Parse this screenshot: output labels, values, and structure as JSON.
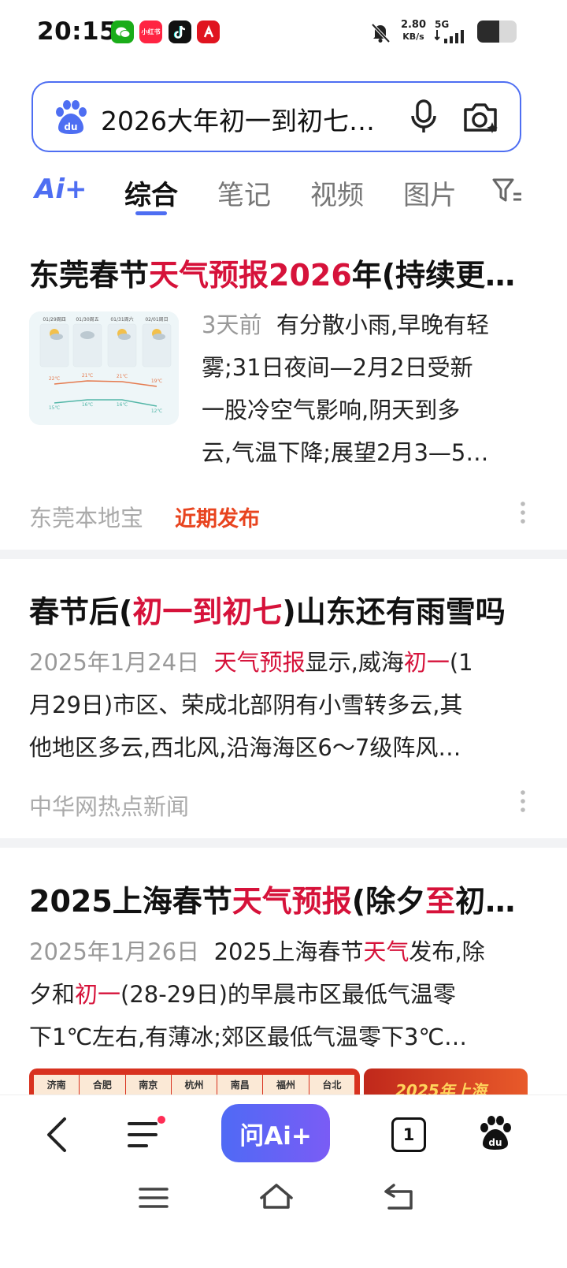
{
  "status_bar": {
    "time": "20:15",
    "app_icons": [
      "wechat-icon",
      "xiaohongshu-icon",
      "tiktok-icon",
      "red-app-icon"
    ],
    "xhs_label": "小红书",
    "net_speed_value": "2.80",
    "net_speed_unit": "KB/s",
    "network": "5G",
    "battery_level": 0.55
  },
  "search": {
    "query": "2026大年初一到初七天气预报"
  },
  "tabs": {
    "ai_label": "Ai+",
    "items": [
      "综合",
      "笔记",
      "视频",
      "图片"
    ],
    "active": "综合"
  },
  "results": [
    {
      "title_parts": [
        "东莞春节",
        "天气预报2026",
        "年(持续更新)"
      ],
      "date": "3天前",
      "snippet": "有分散小雨,早晚有轻雾;31日夜间—2月2日受新一股冷空气影响,阴天到多云,气温下降;展望2月3—5日",
      "snippet_lines": [
        "有分散小雨,早晚有轻",
        "雾;31日夜间—2月2日受新",
        "一股冷空气影响,阴天到多",
        "云,气温下降;展望2月3—5…"
      ],
      "source": "东莞本地宝",
      "tag": "近期发布",
      "thumb": {
        "dates": [
          "01/29周四",
          "01/30周五",
          "01/31周六",
          "02/01周日"
        ],
        "highs": [
          "22℃",
          "21℃",
          "21℃",
          "19℃"
        ],
        "lows": [
          "15℃",
          "16℃",
          "16℃",
          "12℃"
        ]
      }
    },
    {
      "title_parts": [
        "春节后(",
        "初一到初七",
        ")山东还有雨雪吗"
      ],
      "date": "2025年1月24日",
      "snippet_lines": [
        "天气预报显示,威海初一(1",
        "月29日)市区、荣成北部阴有小雪转多云,其",
        "他地区多云,西北风,沿海海区6～7级阵风…"
      ],
      "source": "中华网热点新闻"
    },
    {
      "title_parts": [
        "2025上海春节",
        "天气预报",
        "(除夕",
        "至",
        "初七)"
      ],
      "date": "2025年1月26日",
      "snippet_lines": [
        "2025上海春节天气发布,除",
        "夕和初一(28-29日)的早晨市区最低气温零",
        "下1℃左右,有薄冰;郊区最低气温零下3℃…"
      ],
      "cities": [
        "济南",
        "合肥",
        "南京",
        "杭州",
        "南昌",
        "福州",
        "台北"
      ],
      "banner_text": "2025年上海"
    }
  ],
  "bottom_nav": {
    "ai_button": "问Ai+",
    "tab_count": "1"
  },
  "colors": {
    "accent": "#4e6ef2",
    "highlight": "#d6123a",
    "recent_tag": "#e8441f"
  }
}
